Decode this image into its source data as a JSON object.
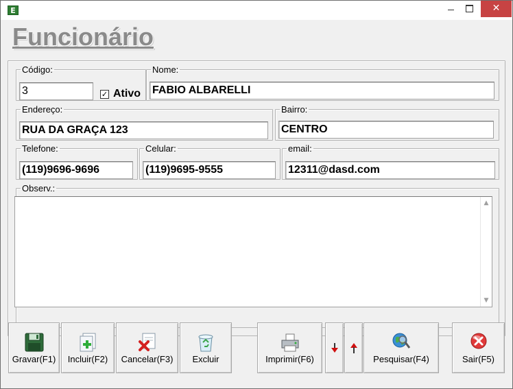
{
  "window": {
    "app_icon_letter": "E",
    "close_glyph": "✕"
  },
  "page": {
    "title": "Funcionário"
  },
  "form": {
    "codigo": {
      "label": "Código:",
      "value": "3"
    },
    "ativo": {
      "label": "Ativo",
      "checked": true,
      "check_glyph": "✓"
    },
    "nome": {
      "label": "Nome:",
      "value": "FABIO ALBARELLI"
    },
    "endereco": {
      "label": "Endereço:",
      "value": "RUA DA GRAÇA 123"
    },
    "bairro": {
      "label": "Bairro:",
      "value": "CENTRO"
    },
    "telefone": {
      "label": "Telefone:",
      "value": "(119)9696-9696"
    },
    "celular": {
      "label": "Celular:",
      "value": "(119)9695-9555"
    },
    "email": {
      "label": "email:",
      "value": "12311@dasd.com"
    },
    "observ": {
      "label": "Observ.:",
      "value": ""
    }
  },
  "scroll": {
    "up_glyph": "▲",
    "down_glyph": "▼"
  },
  "toolbar": {
    "gravar": "Gravar(F1)",
    "incluir": "Incluir(F2)",
    "cancelar": "Cancelar(F3)",
    "excluir": "Excluir",
    "imprimir": "Imprimir(F6)",
    "pesquisar": "Pesquisar(F4)",
    "sair": "Sair(F5)"
  },
  "icons": {
    "gravar": "floppy-disk-icon",
    "incluir": "new-document-plus-icon",
    "cancelar": "document-cancel-icon",
    "excluir": "recycle-bin-icon",
    "imprimir": "printer-icon",
    "prev": "arrow-down-icon",
    "next": "arrow-up-icon",
    "pesquisar": "globe-search-icon",
    "sair": "exit-x-icon"
  },
  "colors": {
    "close_button": "#c74343",
    "title_gray": "#8a8a8a",
    "arrow_red": "#d01010"
  }
}
